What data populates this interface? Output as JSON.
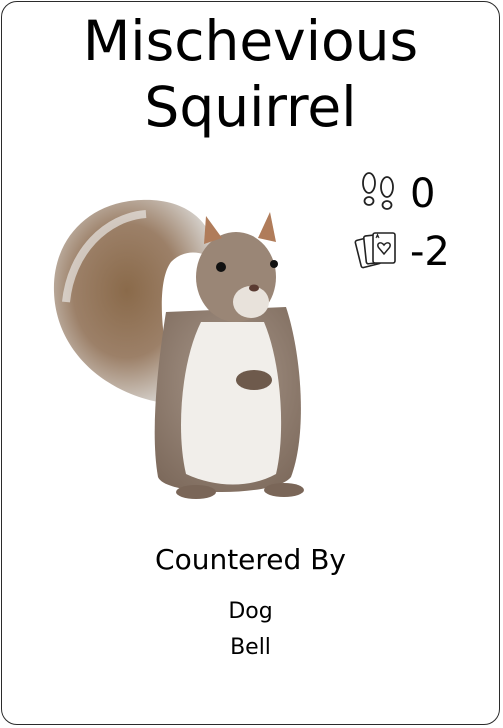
{
  "card": {
    "title_line1": "Mischevious",
    "title_line2": "Squirrel",
    "stats": [
      {
        "icon": "footprints-icon",
        "value": "0"
      },
      {
        "icon": "playing-cards-icon",
        "value": "-2"
      }
    ],
    "illustration": "squirrel-illustration",
    "countered_by": {
      "heading": "Countered By",
      "items": [
        "Dog",
        "Bell"
      ]
    },
    "colors": {
      "border": "#2b2b2b",
      "text": "#000000",
      "background": "#ffffff"
    }
  }
}
